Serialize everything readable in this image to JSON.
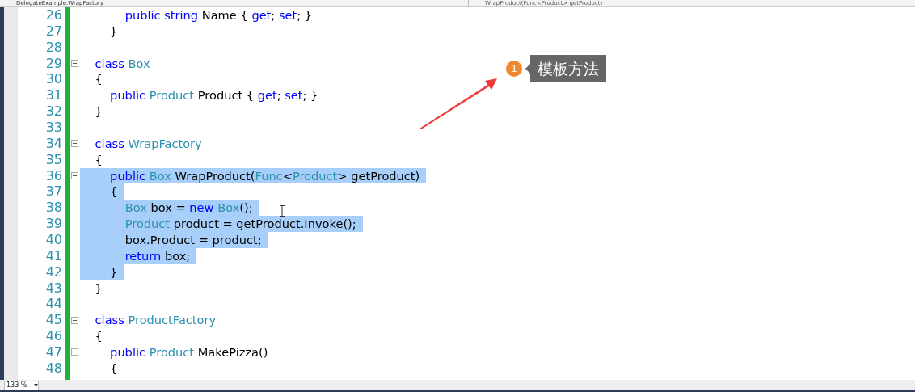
{
  "navigation_bar": {
    "type_scope": "DelegateExample.WrapFactory",
    "member_scope": "WrapProduct(Func<Product> getProduct)"
  },
  "lines": [
    {
      "number": "26",
      "selected": false,
      "fold": false,
      "tokens": [
        {
          "kind": "kw",
          "text": "            public string"
        },
        {
          "kind": "plain",
          "text": " Name { "
        },
        {
          "kind": "kw",
          "text": "get"
        },
        {
          "kind": "plain",
          "text": "; "
        },
        {
          "kind": "kw",
          "text": "set"
        },
        {
          "kind": "plain",
          "text": "; }"
        }
      ]
    },
    {
      "number": "27",
      "selected": false,
      "fold": false,
      "tokens": [
        {
          "kind": "plain",
          "text": "        }"
        }
      ]
    },
    {
      "number": "28",
      "selected": false,
      "fold": false
    },
    {
      "number": "29",
      "selected": false,
      "fold": true,
      "tokens": [
        {
          "kind": "kw",
          "text": "    class"
        },
        {
          "kind": "type",
          "text": " Box"
        }
      ]
    },
    {
      "number": "30",
      "selected": false,
      "fold": false,
      "tokens": [
        {
          "kind": "plain",
          "text": "    {"
        }
      ]
    },
    {
      "number": "31",
      "selected": false,
      "fold": false,
      "tokens": [
        {
          "kind": "kw",
          "text": "        public"
        },
        {
          "kind": "type",
          "text": " Product"
        },
        {
          "kind": "plain",
          "text": " Product { "
        },
        {
          "kind": "kw",
          "text": "get"
        },
        {
          "kind": "plain",
          "text": "; "
        },
        {
          "kind": "kw",
          "text": "set"
        },
        {
          "kind": "plain",
          "text": "; }"
        }
      ]
    },
    {
      "number": "32",
      "selected": false,
      "fold": false,
      "tokens": [
        {
          "kind": "plain",
          "text": "    }"
        }
      ]
    },
    {
      "number": "33",
      "selected": false,
      "fold": false
    },
    {
      "number": "34",
      "selected": false,
      "fold": true,
      "tokens": [
        {
          "kind": "kw",
          "text": "    class"
        },
        {
          "kind": "type",
          "text": " WrapFactory"
        }
      ]
    },
    {
      "number": "35",
      "selected": false,
      "fold": false,
      "tokens": [
        {
          "kind": "plain",
          "text": "    {"
        }
      ]
    },
    {
      "number": "36",
      "selected": true,
      "fold": true,
      "tokens": [
        {
          "kind": "kw",
          "text": "        public"
        },
        {
          "kind": "type",
          "text": " Box"
        },
        {
          "kind": "plain",
          "text": " WrapProduct("
        },
        {
          "kind": "type",
          "text": "Func"
        },
        {
          "kind": "plain",
          "text": "<"
        },
        {
          "kind": "type",
          "text": "Product"
        },
        {
          "kind": "plain",
          "text": "> getProduct)"
        }
      ]
    },
    {
      "number": "37",
      "selected": true,
      "fold": false,
      "tokens": [
        {
          "kind": "plain",
          "text": "        {"
        }
      ]
    },
    {
      "number": "38",
      "selected": true,
      "fold": false,
      "tokens": [
        {
          "kind": "type",
          "text": "            Box"
        },
        {
          "kind": "plain",
          "text": " box = "
        },
        {
          "kind": "kw",
          "text": "new"
        },
        {
          "kind": "type",
          "text": " Box"
        },
        {
          "kind": "plain",
          "text": "();"
        }
      ]
    },
    {
      "number": "39",
      "selected": true,
      "fold": false,
      "tokens": [
        {
          "kind": "type",
          "text": "            Product"
        },
        {
          "kind": "plain",
          "text": " product = getProduct.Invoke();"
        }
      ]
    },
    {
      "number": "40",
      "selected": true,
      "fold": false,
      "tokens": [
        {
          "kind": "plain",
          "text": "            box.Product = product;"
        }
      ]
    },
    {
      "number": "41",
      "selected": true,
      "fold": false,
      "tokens": [
        {
          "kind": "kw",
          "text": "            return"
        },
        {
          "kind": "plain",
          "text": " box;"
        }
      ]
    },
    {
      "number": "42",
      "selected": true,
      "fold": false,
      "tokens": [
        {
          "kind": "plain",
          "text": "        }"
        }
      ]
    },
    {
      "number": "43",
      "selected": false,
      "fold": false,
      "tokens": [
        {
          "kind": "plain",
          "text": "    }"
        }
      ]
    },
    {
      "number": "44",
      "selected": false,
      "fold": false
    },
    {
      "number": "45",
      "selected": false,
      "fold": true,
      "tokens": [
        {
          "kind": "kw",
          "text": "    class"
        },
        {
          "kind": "type",
          "text": " ProductFactory"
        }
      ]
    },
    {
      "number": "46",
      "selected": false,
      "fold": false,
      "tokens": [
        {
          "kind": "plain",
          "text": "    {"
        }
      ]
    },
    {
      "number": "47",
      "selected": false,
      "fold": true,
      "tokens": [
        {
          "kind": "kw",
          "text": "        public"
        },
        {
          "kind": "type",
          "text": " Product"
        },
        {
          "kind": "plain",
          "text": " MakePizza()"
        }
      ]
    },
    {
      "number": "48",
      "selected": false,
      "fold": false,
      "tokens": [
        {
          "kind": "plain",
          "text": "        {"
        }
      ]
    }
  ],
  "callout": {
    "badge": "1",
    "text": "模板方法"
  },
  "status_bar": {
    "zoom": "133 %"
  }
}
